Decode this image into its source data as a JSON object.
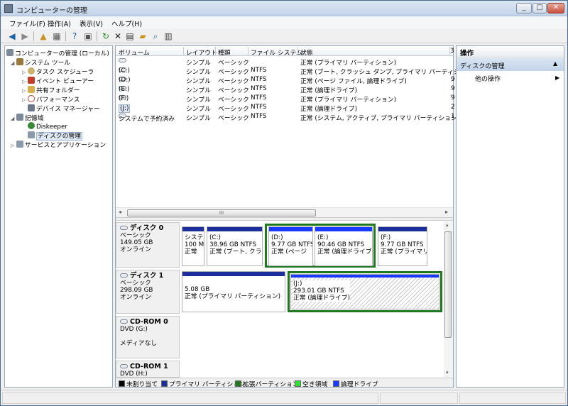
{
  "window": {
    "title": "コンピューターの管理",
    "min": "_",
    "max": "□",
    "close": "✕"
  },
  "menu": [
    "ファイル(F)",
    "操作(A)",
    "表示(V)",
    "ヘルプ(H)"
  ],
  "tree": {
    "root": "コンピューターの管理 (ローカル)",
    "system_tools": "システム ツール",
    "task_scheduler": "タスク スケジューラ",
    "event_viewer": "イベント ビューアー",
    "shared_folders": "共有フォルダー",
    "performance": "パフォーマンス",
    "device_manager": "デバイス マネージャー",
    "storage": "記憶域",
    "diskeeper": "Diskeeper",
    "disk_management": "ディスクの管理",
    "services": "サービスとアプリケーション"
  },
  "table": {
    "headers": [
      "ボリューム",
      "レイアウト",
      "種類",
      "ファイル システム",
      "状態",
      "3"
    ],
    "rows": [
      {
        "volume": "",
        "layout": "シンプル",
        "type": "ベーシック",
        "fs": "",
        "status": "正常 (プライマリ パーティション)",
        "cap": ""
      },
      {
        "volume": "(C:)",
        "layout": "シンプル",
        "type": "ベーシック",
        "fs": "NTFS",
        "status": "正常 (ブート, クラッシュ ダンプ, プライマリ パーティション)",
        "cap": ""
      },
      {
        "volume": "(D:)",
        "layout": "シンプル",
        "type": "ベーシック",
        "fs": "NTFS",
        "status": "正常 (ページ ファイル, 論理ドライブ)",
        "cap": "9"
      },
      {
        "volume": "(E:)",
        "layout": "シンプル",
        "type": "ベーシック",
        "fs": "NTFS",
        "status": "正常 (論理ドライブ)",
        "cap": "9"
      },
      {
        "volume": "(F:)",
        "layout": "シンプル",
        "type": "ベーシック",
        "fs": "NTFS",
        "status": "正常 (プライマリ パーティション)",
        "cap": "9"
      },
      {
        "volume": "(J:)",
        "layout": "シンプル",
        "type": "ベーシック",
        "fs": "NTFS",
        "status": "正常 (論理ドライブ)",
        "cap": "2"
      },
      {
        "volume": "システムで予約済み",
        "layout": "シンプル",
        "type": "ベーシック",
        "fs": "NTFS",
        "status": "正常 (システム, アクティブ, プライマリ パーティション)",
        "cap": "1"
      }
    ],
    "hscroll_grip": "III"
  },
  "disks": {
    "disk0": {
      "name": "ディスク 0",
      "kind": "ベーシック",
      "size": "149.05 GB",
      "state": "オンライン",
      "parts": [
        {
          "l1": "システ",
          "l2": "100 M",
          "l3": "正常"
        },
        {
          "l1": "(C:)",
          "l2": "38.96 GB NTFS",
          "l3": "正常 (ブート, クラッ"
        },
        {
          "l1": "(D:)",
          "l2": "9.77 GB NTFS",
          "l3": "正常 (ページ"
        },
        {
          "l1": "(E:)",
          "l2": "90.46 GB NTFS",
          "l3": "正常 (論理ドライブ"
        },
        {
          "l1": "(F:)",
          "l2": "9.77 GB NTFS",
          "l3": "正常 (プライマリ"
        }
      ]
    },
    "disk1": {
      "name": "ディスク 1",
      "kind": "ベーシック",
      "size": "298.09 GB",
      "state": "オンライン",
      "parts": [
        {
          "l1": "",
          "l2": "5.08 GB",
          "l3": "正常 (プライマリ パーティション)"
        },
        {
          "l1": "(J:)",
          "l2": "293.01 GB NTFS",
          "l3": "正常 (論理ドライブ)"
        }
      ]
    },
    "cdrom0": {
      "name": "CD-ROM 0",
      "drive": "DVD (G:)",
      "state": "メディアなし"
    },
    "cdrom1": {
      "name": "CD-ROM 1",
      "drive": "DVD (H:)"
    }
  },
  "legend": [
    {
      "label": "未割り当て",
      "color": "#000000"
    },
    {
      "label": "プライマリ パーティション",
      "color": "#1b2e9c"
    },
    {
      "label": "拡張パーティション",
      "color": "#1f7a1f"
    },
    {
      "label": "空き領域",
      "color": "#33dd33"
    },
    {
      "label": "論理ドライブ",
      "color": "#1a3bff"
    }
  ],
  "actions": {
    "header": "操作",
    "section": "ディスクの管理",
    "item": "他の操作"
  }
}
